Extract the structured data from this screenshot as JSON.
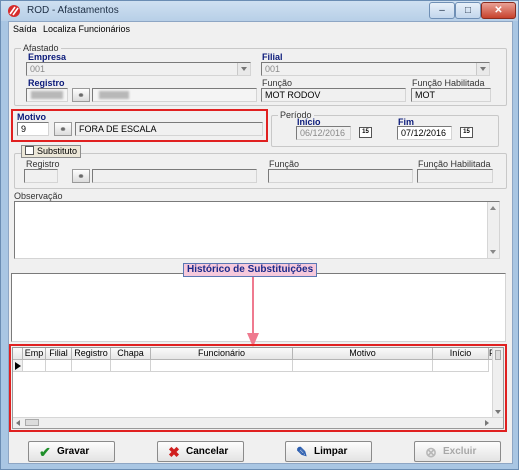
{
  "window": {
    "title": "ROD - Afastamentos"
  },
  "menu": {
    "items": [
      "Saída",
      "Localiza Funcionários"
    ]
  },
  "afastado": {
    "group_title": "Afastado",
    "empresa_label": "Empresa",
    "empresa_value": "001",
    "filial_label": "Filial",
    "filial_value": "001",
    "registro_label": "Registro",
    "funcao_label": "Função",
    "funcao_value": "MOT RODOV",
    "funcao_hab_label": "Função Habilitada",
    "funcao_hab_value": "MOT"
  },
  "motivo": {
    "label": "Motivo",
    "code": "9",
    "description": "FORA DE ESCALA"
  },
  "periodo": {
    "group_title": "Período",
    "inicio_label": "Início",
    "inicio_value": "06/12/2016",
    "fim_label": "Fim",
    "fim_value": "07/12/2016",
    "cal_icon_text": "15"
  },
  "substituto": {
    "checkbox_label": "Substituto",
    "registro_label": "Registro",
    "funcao_label": "Função",
    "funcao_hab_label": "Função Habilitada"
  },
  "observacao": {
    "label": "Observação"
  },
  "historico": {
    "annotation": "Histórico de Substituições",
    "columns": [
      "Emp",
      "Filial",
      "Registro",
      "Chapa",
      "Funcionário",
      "Motivo",
      "Início",
      "Fi"
    ]
  },
  "buttons": {
    "gravar": "Gravar",
    "cancelar": "Cancelar",
    "limpar": "Limpar",
    "excluir": "Excluir"
  },
  "colors": {
    "annotation_red": "#e02020",
    "label_blue": "#0a1a7a",
    "title_bar": "#b7cfe7"
  }
}
